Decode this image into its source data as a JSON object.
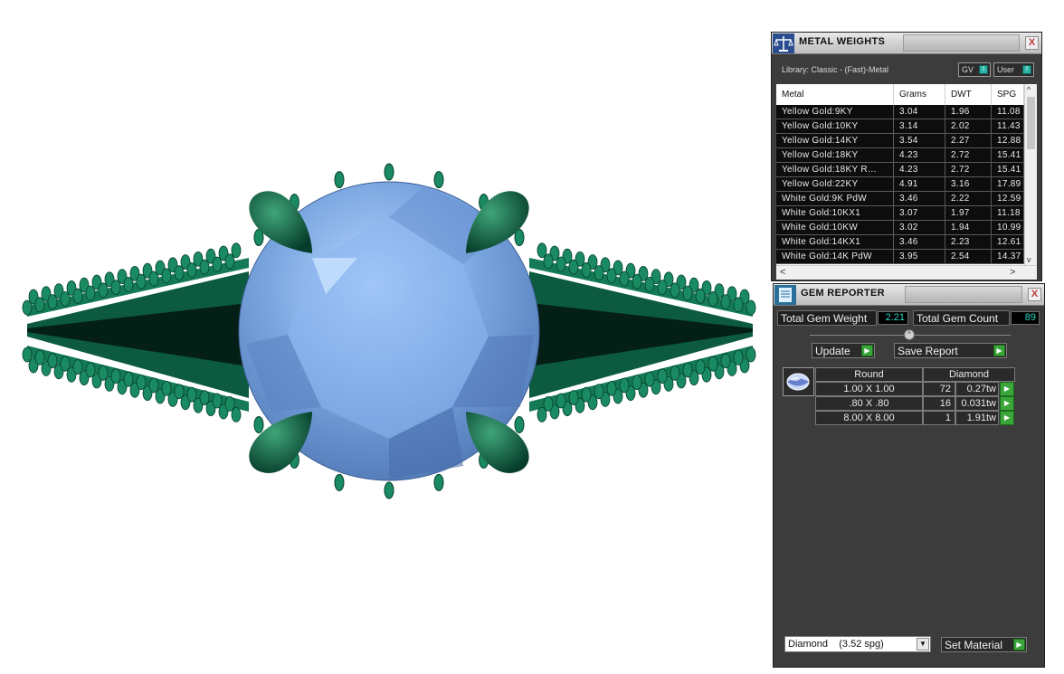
{
  "metal_weights": {
    "title": "METAL WEIGHTS",
    "close_label": "X",
    "library": "Library: Classic - (Fast)-Metal",
    "gv_toggle": "GV",
    "user_toggle": "User",
    "toggle_knob": "I",
    "columns": [
      "Metal",
      "Grams",
      "DWT",
      "SPG"
    ],
    "rows": [
      [
        "Yellow Gold:9KY",
        "3.04",
        "1.96",
        "11.08"
      ],
      [
        "Yellow Gold:10KY",
        "3.14",
        "2.02",
        "11.43"
      ],
      [
        "Yellow Gold:14KY",
        "3.54",
        "2.27",
        "12.88"
      ],
      [
        "Yellow Gold:18KY",
        "4.23",
        "2.72",
        "15.41"
      ],
      [
        "Yellow Gold:18KY R…",
        "4.23",
        "2.72",
        "15.41"
      ],
      [
        "Yellow Gold:22KY",
        "4.91",
        "3.16",
        "17.89"
      ],
      [
        "White Gold:9K PdW",
        "3.46",
        "2.22",
        "12.59"
      ],
      [
        "White Gold:10KX1",
        "3.07",
        "1.97",
        "11.18"
      ],
      [
        "White Gold:10KW",
        "3.02",
        "1.94",
        "10.99"
      ],
      [
        "White Gold:14KX1",
        "3.46",
        "2.23",
        "12.61"
      ],
      [
        "White Gold:14K PdW",
        "3.95",
        "2.54",
        "14.37"
      ]
    ],
    "scroll_up": "^",
    "scroll_down": "v",
    "scroll_left": "<",
    "scroll_right": ">"
  },
  "gem_reporter": {
    "title": "GEM REPORTER",
    "close_label": "X",
    "total_weight_label": "Total Gem Weight",
    "total_weight_value": "2.21",
    "total_count_label": "Total Gem Count",
    "total_count_value": "89",
    "update_label": "Update",
    "save_report_label": "Save Report",
    "arrow_glyph": "▶",
    "grid_header_shape": "Round",
    "grid_header_type": "Diamond",
    "gems": [
      {
        "size": "1.00 X 1.00",
        "count": "72",
        "weight": "0.27tw"
      },
      {
        "size": ".80 X .80",
        "count": "16",
        "weight": "0.031tw"
      },
      {
        "size": "8.00 X 8.00",
        "count": "1",
        "weight": "1.91tw"
      }
    ],
    "material_select": "Diamond    (3.52 spg)",
    "select_arrow": "▼",
    "set_material_label": "Set Material"
  },
  "colors": {
    "metal_green": "#0f6e4e",
    "gem_blue": "#7aa6e0",
    "panel_bg": "#3c3c3c",
    "accent_teal": "#2bd6c0",
    "button_green": "#3aa63a"
  }
}
